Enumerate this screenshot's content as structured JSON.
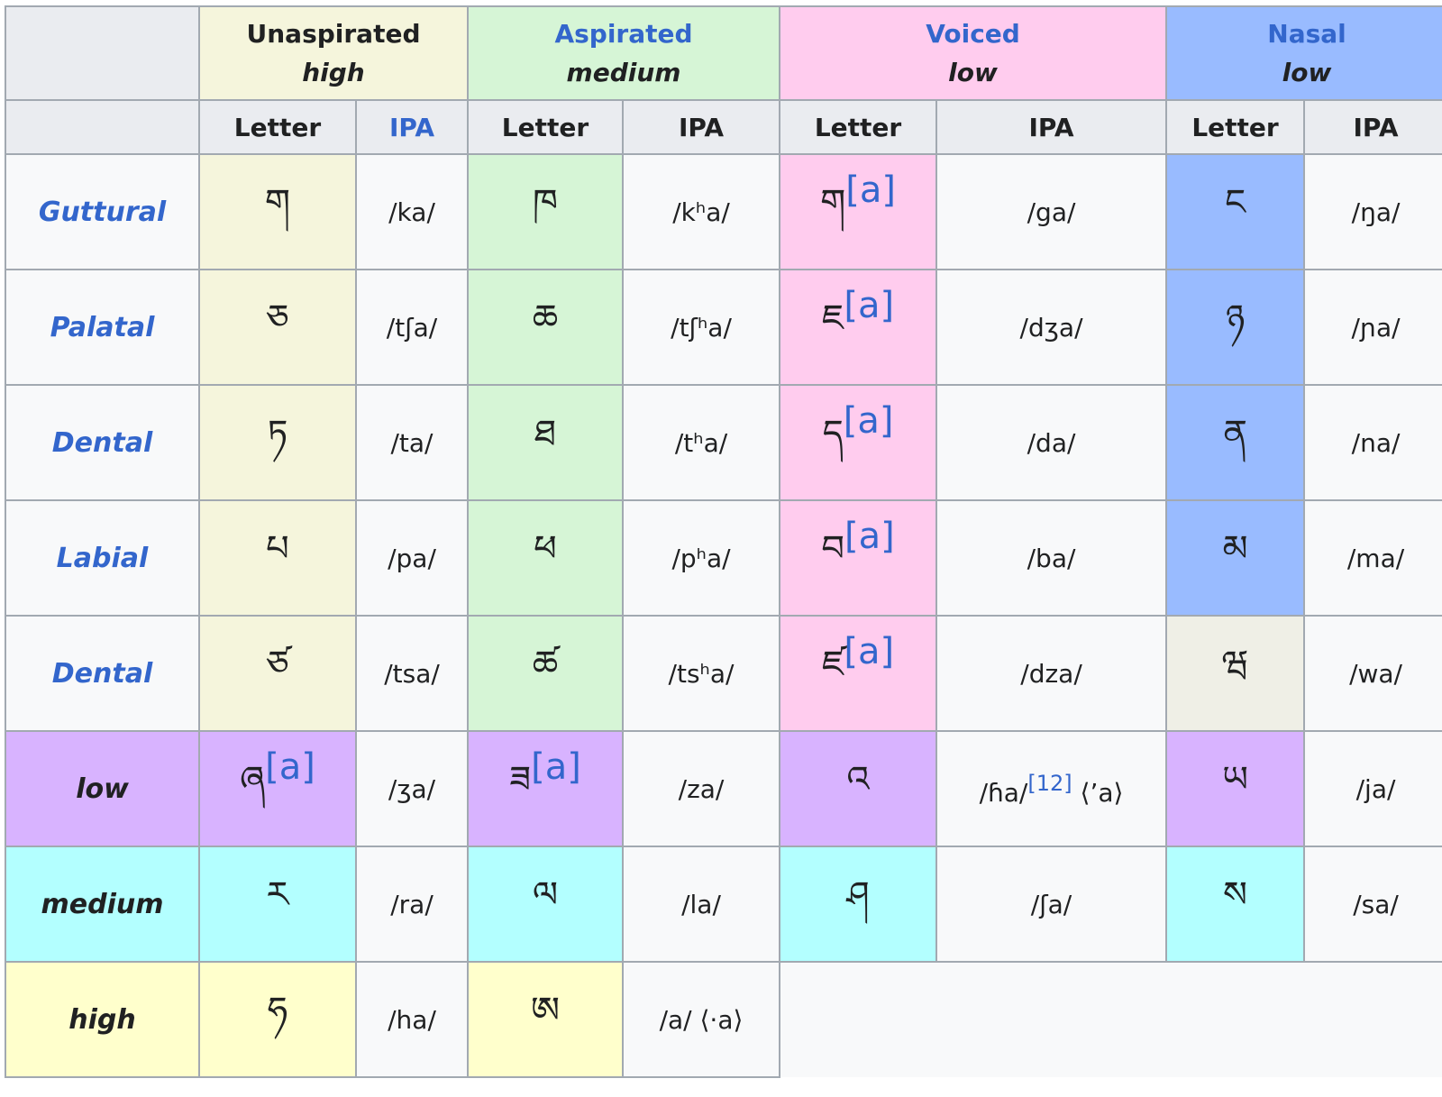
{
  "headers": {
    "unaspirated": {
      "label": "Unaspirated",
      "tone": "high"
    },
    "aspirated": {
      "label": "Aspirated",
      "tone": "medium"
    },
    "voiced": {
      "label": "Voiced",
      "tone": "low"
    },
    "nasal": {
      "label": "Nasal",
      "tone": "low"
    }
  },
  "subheaders": {
    "letter": "Letter",
    "ipa": "IPA"
  },
  "ref_a": "[a]",
  "ref_12": "[12]",
  "rows": [
    {
      "label": "Guttural",
      "cells": [
        "ག",
        "/ka/",
        "ཁ",
        "/kʰa/",
        "ག",
        "/ga/",
        "ང",
        "/ŋa/"
      ]
    },
    {
      "label": "Palatal",
      "cells": [
        "ཅ",
        "/tʃa/",
        "ཆ",
        "/tʃʰa/",
        "ཇ",
        "/dʒa/",
        "ཉ",
        "/ɲa/"
      ]
    },
    {
      "label": "Dental",
      "cells": [
        "ཏ",
        "/ta/",
        "ཐ",
        "/tʰa/",
        "ད",
        "/da/",
        "ན",
        "/na/"
      ]
    },
    {
      "label": "Labial",
      "cells": [
        "པ",
        "/pa/",
        "ཕ",
        "/pʰa/",
        "བ",
        "/ba/",
        "མ",
        "/ma/"
      ]
    },
    {
      "label": "Dental",
      "cells": [
        "ཙ",
        "/tsa/",
        "ཚ",
        "/tsʰa/",
        "ཛ",
        "/dza/",
        "ཝ",
        "/wa/"
      ]
    },
    {
      "label": "low",
      "cells": [
        "ཞ",
        "/ʒa/",
        "ཟ",
        "/za/",
        "འ",
        "/ɦa/",
        "⟨’a⟩",
        "ཡ",
        "/ja/"
      ]
    },
    {
      "label": "medium",
      "cells": [
        "ར",
        "/ra/",
        "ལ",
        "/la/",
        "ཤ",
        "/ʃa/",
        "ས",
        "/sa/"
      ]
    },
    {
      "label": "high",
      "cells": [
        "ཧ",
        "/ha/",
        "ཨ",
        "/a/ ⟨·a⟩"
      ]
    }
  ]
}
